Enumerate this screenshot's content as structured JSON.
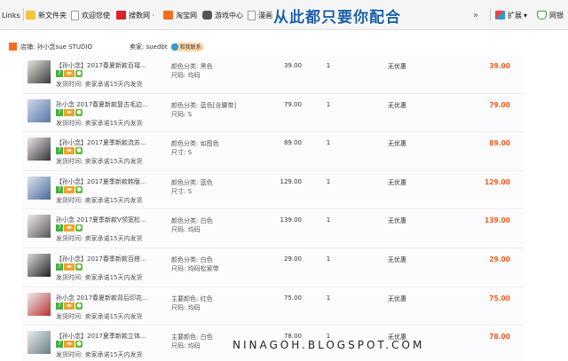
{
  "bookmarks": [
    {
      "label": "Links",
      "icon": "none"
    },
    {
      "label": "新文件夹",
      "icon": "folder-icon"
    },
    {
      "label": "欢迎您使",
      "icon": "page-icon"
    },
    {
      "label": "搜数网 ·",
      "icon": "sou-icon"
    },
    {
      "label": "淘宝网",
      "icon": "taobao-icon"
    },
    {
      "label": "游戏中心",
      "icon": "game-icon"
    },
    {
      "label": "漫画",
      "icon": "page-icon"
    }
  ],
  "toolbar": {
    "extensions_label": "扩展",
    "security_label": "网银"
  },
  "banner": "从此都只要你配合",
  "shop": {
    "store_label": "店铺: 孙小念sue STUDIO",
    "seller_label": "卖家: suedbt",
    "wangwang_label": "和我联系"
  },
  "badges": {
    "seven": "7",
    "card": "▬",
    "leaf": "●"
  },
  "orders": [
    {
      "title": "【孙小念】2017春夏新款百褶…",
      "attr1": "颜色分类: 黑色",
      "attr2": "尺码: 均码",
      "ship": "发货时间: 卖家承诺15天内发货",
      "price": "39.00",
      "qty": "1",
      "discount": "无优惠",
      "total": "39.00"
    },
    {
      "title": "孙小念 2017春夏新款复古毛边…",
      "attr1": "颜色分类: 蓝色[含腰带]",
      "attr2": "尺码: S",
      "ship": "发货时间: 卖家承诺15天内发货",
      "price": "79.00",
      "qty": "1",
      "discount": "无优惠",
      "total": "79.00"
    },
    {
      "title": "【孙小念】2017夏季新款流苏…",
      "attr1": "颜色分类: 如图色",
      "attr2": "尺寸: S",
      "ship": "发货时间: 卖家承诺15天内发货",
      "price": "89.00",
      "qty": "1",
      "discount": "无优惠",
      "total": "89.00"
    },
    {
      "title": "【孙小念】2017夏季新款韩版…",
      "attr1": "颜色分类: 蓝色",
      "attr2": "尺寸: S",
      "ship": "发货时间: 卖家承诺15天内发货",
      "price": "129.00",
      "qty": "1",
      "discount": "无优惠",
      "total": "129.00"
    },
    {
      "title": "孙小念 2017夏季新款V领宽松…",
      "attr1": "颜色分类: 白色",
      "attr2": "尺码: 均码",
      "ship": "发货时间: 卖家承诺15天内发货",
      "price": "139.00",
      "qty": "1",
      "discount": "无优惠",
      "total": "139.00"
    },
    {
      "title": "【孙小念】2017春季新款百搭…",
      "attr1": "颜色分类: 白色",
      "attr2": "尺码: 均码松紧带",
      "ship": "发货时间: 卖家承诺15天内发货",
      "price": "29.00",
      "qty": "1",
      "discount": "无优惠",
      "total": "29.00"
    },
    {
      "title": "孙小念 2017春夏新款背后印花…",
      "attr1": "主要颜色: 红色",
      "attr2": "尺码: 均码",
      "ship": "发货时间: 卖家承诺15天内发货",
      "price": "75.00",
      "qty": "1",
      "discount": "无优惠",
      "total": "75.00"
    },
    {
      "title": "【孙小念】2017夏季新款立体…",
      "attr1": "主要颜色: 白色",
      "attr2": "尺码: 均码",
      "ship": "发货时间: 卖家承诺15天内发货",
      "price": "78.00",
      "qty": "1",
      "discount": "无优惠",
      "total": "78.00"
    }
  ],
  "watermark": "NINAGOH.BLOGSPOT.COM"
}
